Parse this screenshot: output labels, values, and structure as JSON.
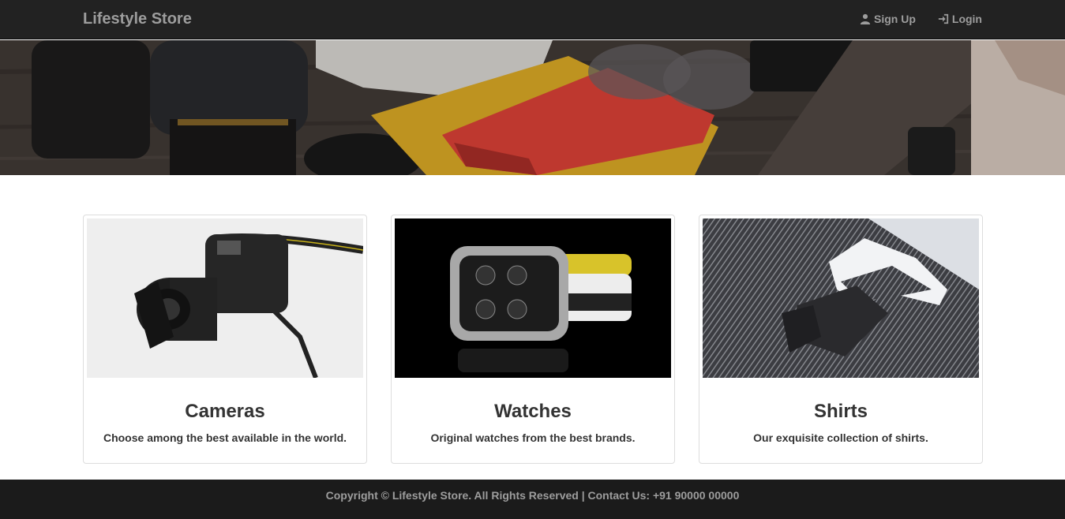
{
  "navbar": {
    "brand": "Lifestyle Store",
    "links": [
      {
        "label": "Sign Up",
        "icon": "user-icon"
      },
      {
        "label": "Login",
        "icon": "log-in-icon"
      }
    ]
  },
  "products": [
    {
      "title": "Cameras",
      "description": "Choose among the best available in the world.",
      "image": "camera-image"
    },
    {
      "title": "Watches",
      "description": "Original watches from the best brands.",
      "image": "watch-image"
    },
    {
      "title": "Shirts",
      "description": "Our exquisite collection of shirts.",
      "image": "shirt-image"
    }
  ],
  "footer": {
    "text": "Copyright © Lifestyle Store. All Rights Reserved | Contact Us: +91 90000 00000"
  },
  "colors": {
    "navbar_bg": "#222222",
    "footer_bg": "#1b1b1b",
    "nav_text": "#9d9d9d",
    "heading_text": "#333333"
  }
}
